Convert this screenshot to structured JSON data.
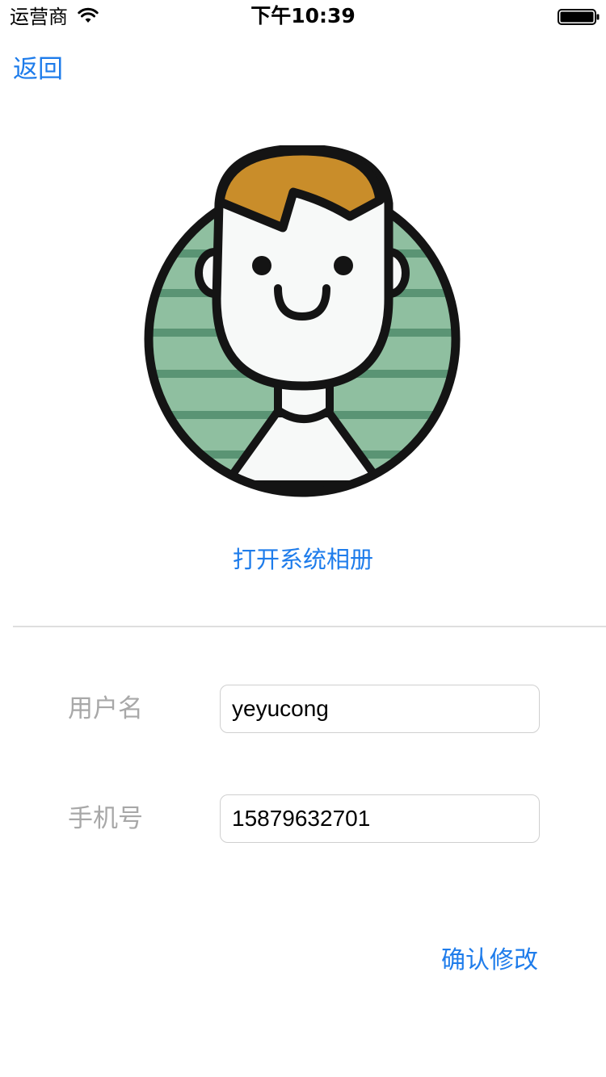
{
  "status_bar": {
    "carrier": "运营商",
    "time": "下午10:39",
    "wifi_icon": "wifi-icon",
    "battery_icon": "battery-icon"
  },
  "nav": {
    "back_label": "返回"
  },
  "avatar": {
    "icon": "cartoon-boy-avatar",
    "colors": {
      "hair": "#C98D2A",
      "stripes_light": "#8FBFA0",
      "stripes_dark": "#5A9474",
      "skin": "#F7F9F8",
      "outline": "#141414"
    }
  },
  "open_album_label": "打开系统相册",
  "form": {
    "username_label": "用户名",
    "username_value": "yeyucong",
    "phone_label": "手机号",
    "phone_value": "15879632701"
  },
  "confirm_label": "确认修改",
  "accent_color": "#1E7CEB"
}
